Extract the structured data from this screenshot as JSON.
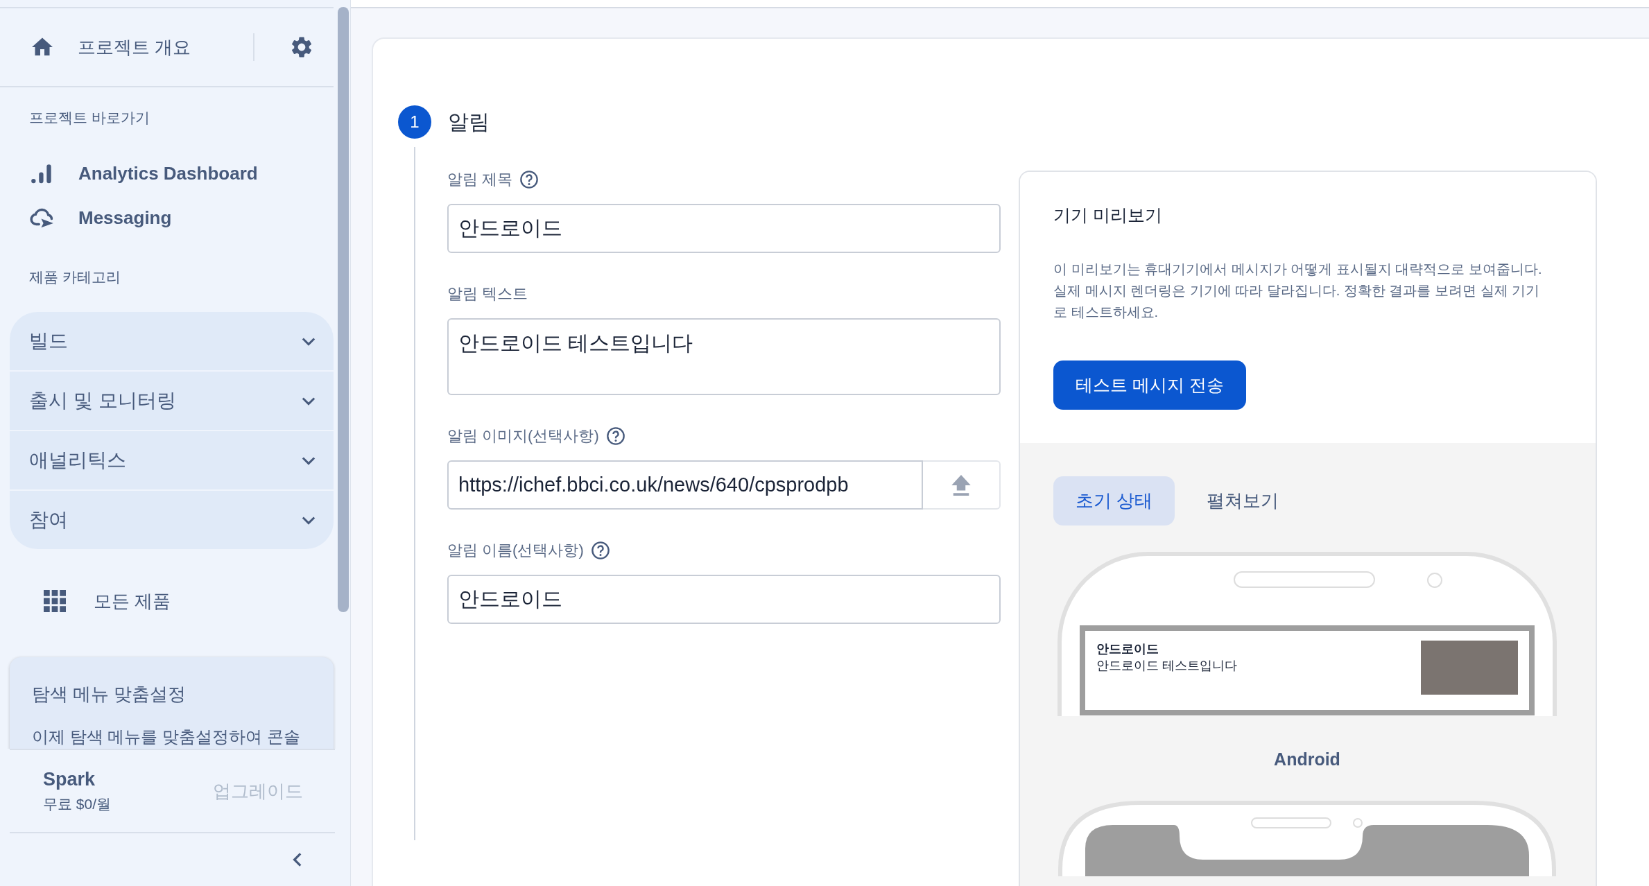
{
  "sidebar": {
    "header": {
      "title": "프로젝트 개요"
    },
    "shortcuts_label": "프로젝트 바로가기",
    "shortcuts": [
      {
        "label": "Analytics Dashboard",
        "kind": "analytics"
      },
      {
        "label": "Messaging",
        "kind": "messaging"
      }
    ],
    "categories_label": "제품 카테고리",
    "categories": [
      {
        "label": "빌드",
        "expanded": false
      },
      {
        "label": "출시 및 모니터링",
        "expanded": false
      },
      {
        "label": "애널리틱스",
        "expanded": false
      },
      {
        "label": "참여",
        "expanded": false
      }
    ],
    "all_products": "모든 제품",
    "promo": {
      "title": "탐색 메뉴 맞춤설정",
      "text": "이제 탐색 메뉴를 맞춤설정하여 콘솔"
    },
    "plan": {
      "name": "Spark",
      "price": "무료 $0/월",
      "upgrade": "업그레이드"
    }
  },
  "step": {
    "number": "1",
    "title": "알림"
  },
  "form": {
    "fields": [
      {
        "label": "알림 제목",
        "help": true,
        "kind": "input",
        "value": "안드로이드"
      },
      {
        "label": "알림 텍스트",
        "help": false,
        "kind": "textarea",
        "value": "안드로이드 테스트입니다"
      },
      {
        "label": "알림 이미지(선택사항)",
        "help": true,
        "kind": "upload",
        "value": "https://ichef.bbci.co.uk/news/640/cpsprodpb"
      },
      {
        "label": "알림 이름(선택사항)",
        "help": true,
        "kind": "input",
        "value": "안드로이드"
      }
    ]
  },
  "preview": {
    "title": "기기 미리보기",
    "description": "이 미리보기는 휴대기기에서 메시지가 어떻게 표시될지 대략적으로 보여줍니다. 실제 메시지 렌더링은 기기에 따라 달라집니다. 정확한 결과를 보려면 실제 기기로 테스트하세요.",
    "send_button": "테스트 메시지 전송",
    "tabs": [
      {
        "label": "초기 상태",
        "selected": true
      },
      {
        "label": "펼쳐보기",
        "selected": false
      }
    ],
    "notification": {
      "title": "안드로이드",
      "text": "안드로이드 테스트입니다"
    },
    "device_label": "Android"
  }
}
